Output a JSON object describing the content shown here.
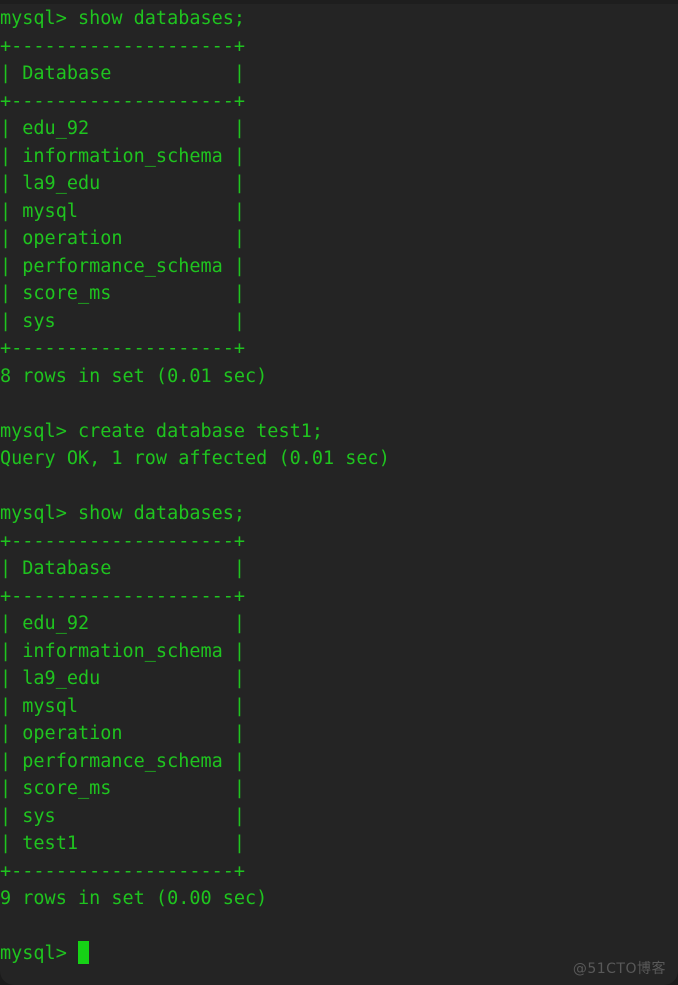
{
  "terminal": {
    "app": "mysql-client-terminal",
    "background_color": "#242424",
    "text_color": "#1fc41f",
    "cursor_color": "#16d216",
    "prompt": "mysql> ",
    "lines": [
      "mysql> show databases;",
      "+--------------------+",
      "| Database           |",
      "+--------------------+",
      "| edu_92             |",
      "| information_schema |",
      "| la9_edu            |",
      "| mysql              |",
      "| operation          |",
      "| performance_schema |",
      "| score_ms           |",
      "| sys                |",
      "+--------------------+",
      "8 rows in set (0.01 sec)",
      "",
      "mysql> create database test1;",
      "Query OK, 1 row affected (0.01 sec)",
      "",
      "mysql> show databases;",
      "+--------------------+",
      "| Database           |",
      "+--------------------+",
      "| edu_92             |",
      "| information_schema |",
      "| la9_edu            |",
      "| mysql              |",
      "| operation          |",
      "| performance_schema |",
      "| score_ms           |",
      "| sys                |",
      "| test1              |",
      "+--------------------+",
      "9 rows in set (0.00 sec)",
      ""
    ],
    "final_prompt": "mysql> ",
    "commands": [
      "show databases;",
      "create database test1;",
      "show databases;"
    ],
    "results": [
      {
        "column_header": "Database",
        "rows": [
          "edu_92",
          "information_schema",
          "la9_edu",
          "mysql",
          "operation",
          "performance_schema",
          "score_ms",
          "sys"
        ],
        "status": "8 rows in set (0.01 sec)",
        "row_count": 8,
        "duration_sec": "0.01"
      },
      {
        "column_header": "",
        "rows": [],
        "status": "Query OK, 1 row affected (0.01 sec)",
        "row_count": 1,
        "duration_sec": "0.01"
      },
      {
        "column_header": "Database",
        "rows": [
          "edu_92",
          "information_schema",
          "la9_edu",
          "mysql",
          "operation",
          "performance_schema",
          "score_ms",
          "sys",
          "test1"
        ],
        "status": "9 rows in set (0.00 sec)",
        "row_count": 9,
        "duration_sec": "0.00"
      }
    ]
  },
  "watermark": {
    "text": "@51CTO博客",
    "color": "#595959"
  }
}
